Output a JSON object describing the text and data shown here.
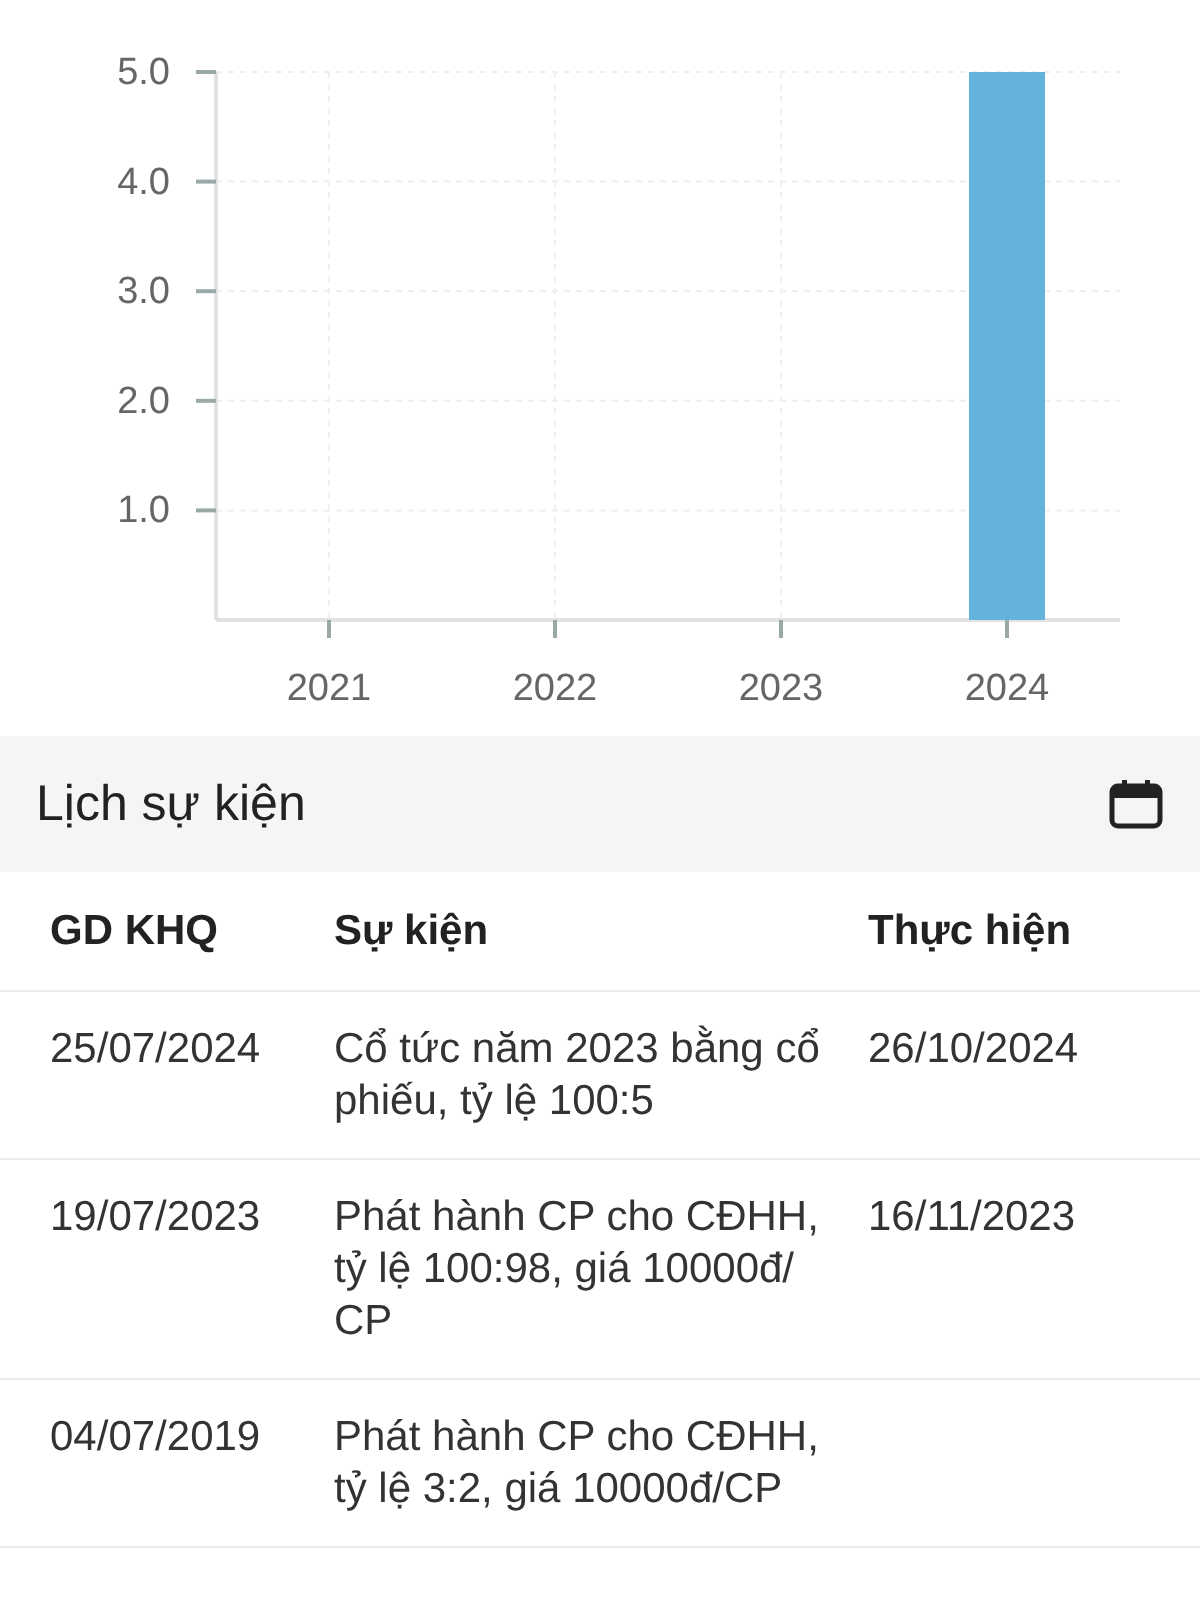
{
  "chart": {
    "chart_data": {
      "type": "bar",
      "grid": true,
      "categories": [
        "2021",
        "2022",
        "2023",
        "2024"
      ],
      "series": [
        {
          "color": "#63b3dc",
          "values": [
            0,
            0,
            0,
            5
          ]
        }
      ],
      "ylim": [
        0,
        5
      ],
      "yticks": [
        {
          "value": 1,
          "label": "1.0"
        },
        {
          "value": 2,
          "label": "2.0"
        },
        {
          "value": 3,
          "label": "3.0"
        },
        {
          "value": 4,
          "label": "4.0"
        },
        {
          "value": 5,
          "label": "5.0"
        }
      ]
    }
  },
  "events": {
    "title": "Lịch sự kiện",
    "columns": [
      "GD KHQ",
      "Sự kiện",
      "Thực hiện"
    ],
    "rows": [
      {
        "ex_date": "25/07/2024",
        "event": "Cổ tức năm 2023 bằng cổ phiếu, tỷ lệ 100:5",
        "exec_date": "26/10/2024"
      },
      {
        "ex_date": "19/07/2023",
        "event": "Phát hành CP cho CĐHH, tỷ lệ 100:98, giá 10000đ/ CP",
        "exec_date": "16/11/2023"
      },
      {
        "ex_date": "04/07/2019",
        "event": "Phát hành CP cho CĐHH, tỷ lệ 3:2, giá 10000đ/CP"
      }
    ]
  }
}
